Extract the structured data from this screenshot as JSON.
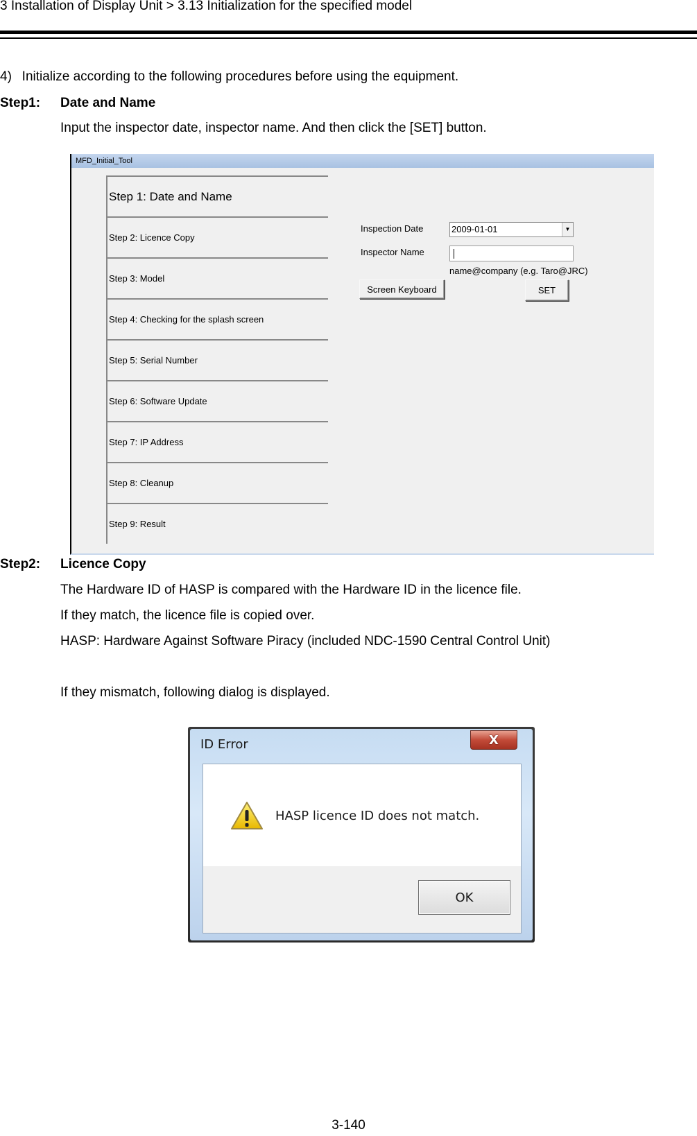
{
  "header": {
    "breadcrumb": "3 Installation of Display Unit > 3.13 Initialization for the specified model"
  },
  "intro": "4)  Initialize according to the following procedures before using the equipment.",
  "step1": {
    "label": "Step1:",
    "title": "Date and Name",
    "description": "Input the inspector date, inspector name. And then click the [SET] button."
  },
  "tool_window": {
    "title": "MFD_Initial_Tool",
    "steps": [
      {
        "label": "Step 1: Date and Name",
        "active": true
      },
      {
        "label": "Step 2: Licence Copy",
        "active": false
      },
      {
        "label": "Step 3: Model",
        "active": false
      },
      {
        "label": "Step 4: Checking for the splash screen",
        "active": false
      },
      {
        "label": "Step 5: Serial Number",
        "active": false
      },
      {
        "label": "Step 6: Software Update",
        "active": false
      },
      {
        "label": "Step 7: IP Address",
        "active": false
      },
      {
        "label": "Step 8: Cleanup",
        "active": false
      },
      {
        "label": "Step 9: Result",
        "active": false
      }
    ],
    "form": {
      "inspection_date_label": "Inspection Date",
      "inspection_date_value": "2009-01-01",
      "inspector_name_label": "Inspector Name",
      "inspector_name_value": "",
      "name_hint": "name@company (e.g. Taro@JRC)",
      "screen_keyboard_button": "Screen Keyboard",
      "set_button": "SET"
    }
  },
  "step2": {
    "label": "Step2:",
    "title": "Licence Copy",
    "lines": [
      "The Hardware ID of HASP is compared with the Hardware ID in the licence file.",
      "If they match, the licence file is copied over.",
      "HASP: Hardware Against Software Piracy (included NDC-1590 Central Control Unit)"
    ],
    "mismatch_note": "If they mismatch, following dialog is displayed."
  },
  "dialog": {
    "title": "ID Error",
    "close_glyph": "X",
    "icon": "warning-icon",
    "message": "HASP licence ID does not match.",
    "ok_button": "OK"
  },
  "footer": {
    "page_number": "3-140"
  }
}
